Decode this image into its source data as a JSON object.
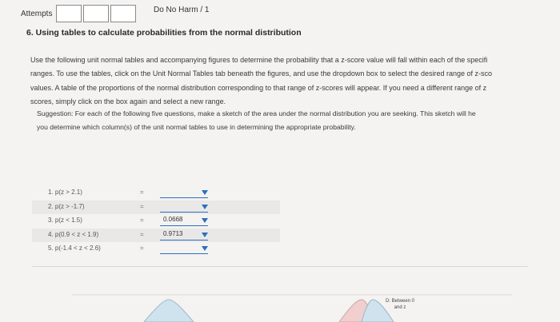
{
  "header": {
    "attempts_label": "Attempts",
    "score_label": "Do No Harm / 1"
  },
  "question": {
    "title": "6. Using tables to calculate probabilities from the normal distribution",
    "instructions": [
      "Use the following unit normal tables and accompanying figures to determine the probability that a z-score value will fall within each of the specifi",
      "ranges. To use the tables, click on the Unit Normal Tables tab beneath the figures, and use the dropdown box to select the desired range of z-sco",
      "values. A table of the proportions of the normal distribution corresponding to that range of z-scores will appear. If you need a different range of z",
      "scores, simply click on the box again and select a new range."
    ],
    "suggestion": [
      "Suggestion: For each of the following five questions, make a sketch of the area under the normal distribution you are seeking. This sketch will he",
      "you determine which column(s) of the unit normal tables to use in determining the appropriate probability."
    ]
  },
  "items": [
    {
      "label": "1.  p(z > 2.1)",
      "eq": "=",
      "value": ""
    },
    {
      "label": "2.  p(z > -1.7)",
      "eq": "=",
      "value": ""
    },
    {
      "label": "3.  p(z < 1.5)",
      "eq": "=",
      "value": "0.0668"
    },
    {
      "label": "4.  p(0.9 < z < 1.9)",
      "eq": "=",
      "value": "0.9713"
    },
    {
      "label": "5.  p(-1.4 < z < 2.6)",
      "eq": "=",
      "value": ""
    }
  ],
  "figure": {
    "label_line1": "D: Between 0",
    "label_line2": "and z"
  },
  "colors": {
    "accent": "#2a6fc4"
  }
}
